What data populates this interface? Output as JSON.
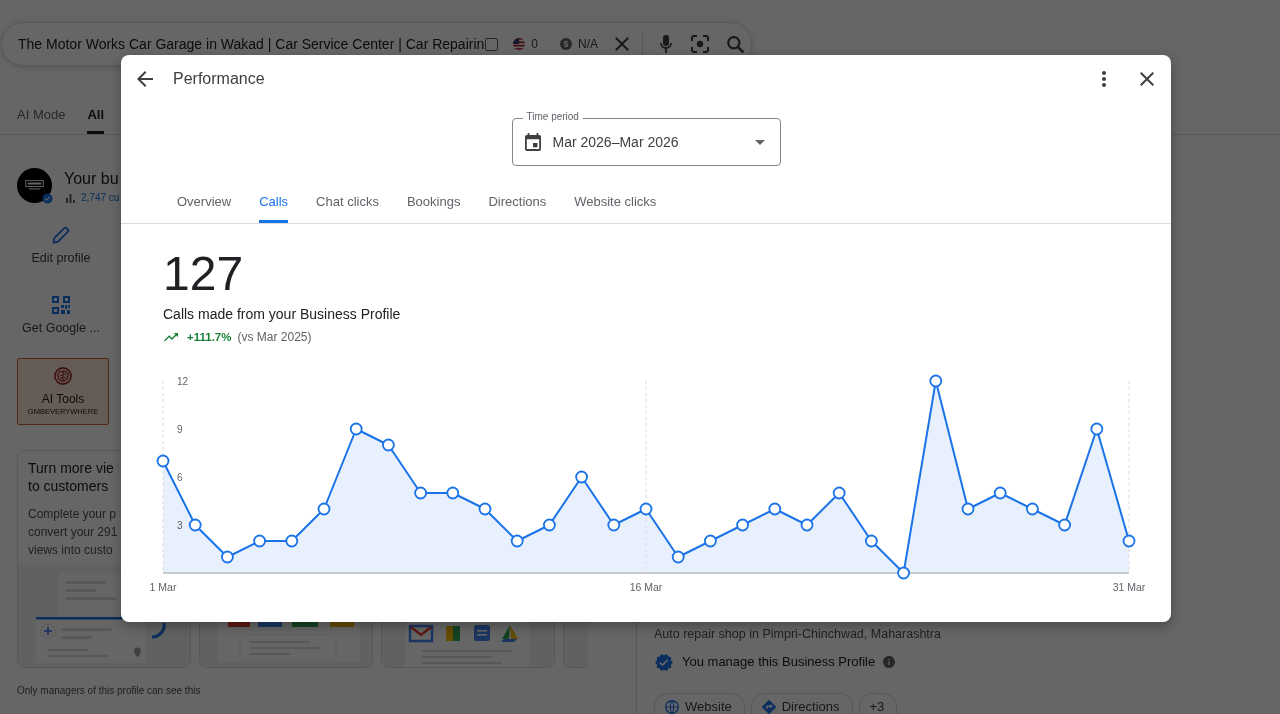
{
  "search_bar": {
    "query": "The Motor Works Car Garage in Wakad | Car Service Center | Car Repairin",
    "checkbox": {
      "checked": false
    },
    "flag_value": "0",
    "currency_symbol": "$",
    "price": "N/A"
  },
  "search_tabs": [
    {
      "label": "AI Mode",
      "selected": false
    },
    {
      "label": "All",
      "selected": true
    }
  ],
  "business_panel": {
    "name": "Your bu",
    "interactions": "2,747 cu",
    "actions": [
      {
        "kind": "edit",
        "label": "Edit profile"
      },
      {
        "kind": "qr",
        "label": "Get Google ..."
      }
    ],
    "ai_tools": {
      "title": "AI Tools",
      "subtitle": "GMBEVERYWHERE"
    },
    "cards": [
      {
        "kind": "text",
        "title_lines": [
          "Turn more vie",
          "to customers"
        ],
        "body_lines": [
          "Complete your p",
          "convert your 291",
          "views into custo"
        ]
      },
      {
        "kind": "preview"
      },
      {
        "kind": "apps"
      },
      {
        "kind": "blank"
      }
    ],
    "note": "Only managers of this profile can see this"
  },
  "profile_summary": {
    "category": "Auto repair shop in Pimpri-Chinchwad, Maharashtra",
    "managed_note": "You manage this Business Profile",
    "chips": [
      {
        "kind": "website",
        "label": "Website"
      },
      {
        "kind": "directions",
        "label": "Directions"
      },
      {
        "kind": "more",
        "label": "+3"
      }
    ]
  },
  "dialog": {
    "title": "Performance",
    "time_period": {
      "label": "Time period",
      "value": "Mar 2026–Mar 2026"
    },
    "tabs": [
      {
        "label": "Overview",
        "selected": false
      },
      {
        "label": "Calls",
        "selected": true
      },
      {
        "label": "Chat clicks",
        "selected": false
      },
      {
        "label": "Bookings",
        "selected": false
      },
      {
        "label": "Directions",
        "selected": false
      },
      {
        "label": "Website clicks",
        "selected": false
      }
    ],
    "metric": {
      "value": "127",
      "caption": "Calls made from your Business Profile",
      "change": "+111.7%",
      "comparison": "(vs Mar 2025)"
    },
    "chart_data": {
      "type": "area",
      "categories": [
        "1 Mar",
        null,
        null,
        null,
        null,
        null,
        null,
        null,
        null,
        null,
        null,
        null,
        null,
        null,
        null,
        "16 Mar",
        null,
        null,
        null,
        null,
        null,
        null,
        null,
        null,
        null,
        null,
        null,
        null,
        null,
        null,
        "31 Mar"
      ],
      "values": [
        7,
        3,
        1,
        2,
        2,
        4,
        9,
        8,
        5,
        5,
        4,
        2,
        3,
        6,
        3,
        4,
        1,
        2,
        3,
        4,
        3,
        5,
        2,
        0,
        12,
        4,
        5,
        4,
        3,
        9,
        2
      ],
      "ylim": [
        0,
        12
      ],
      "yticks": [
        3,
        6,
        9,
        12
      ]
    }
  }
}
